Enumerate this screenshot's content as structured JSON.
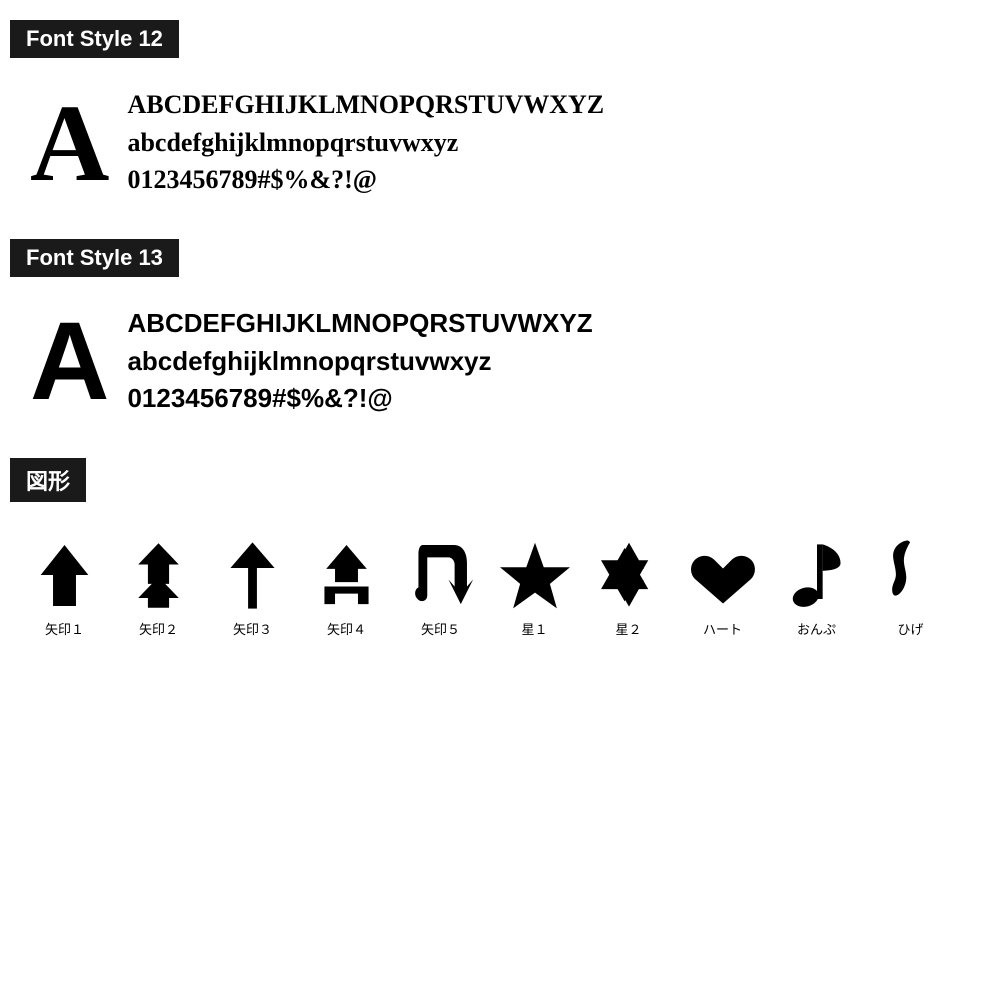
{
  "sections": {
    "font12": {
      "title": "Font Style 12",
      "bigLetter": "A",
      "line1": "ABCDEFGHIJKLMNOPQRSTUVWXYZ",
      "line2": "abcdefghijklmnopqrstuvwxyz",
      "line3": "0123456789#$%&?!@"
    },
    "font13": {
      "title": "Font Style 13",
      "bigLetter": "A",
      "line1": "ABCDEFGHIJKLMNOPQRSTUVWXYZ",
      "line2": "abcdefghijklmnopqrstuvwxyz",
      "line3": "0123456789#$%&?!@"
    },
    "shapes": {
      "title": "図形",
      "items": [
        {
          "label": "矢印１",
          "type": "arrow1"
        },
        {
          "label": "矢印２",
          "type": "arrow2"
        },
        {
          "label": "矢印３",
          "type": "arrow3"
        },
        {
          "label": "矢印４",
          "type": "arrow4"
        },
        {
          "label": "矢印５",
          "type": "arrow5"
        },
        {
          "label": "星１",
          "type": "star1"
        },
        {
          "label": "星２",
          "type": "star2"
        },
        {
          "label": "ハート",
          "type": "heart"
        },
        {
          "label": "おんぷ",
          "type": "music"
        },
        {
          "label": "ひげ",
          "type": "mustache"
        }
      ]
    }
  }
}
